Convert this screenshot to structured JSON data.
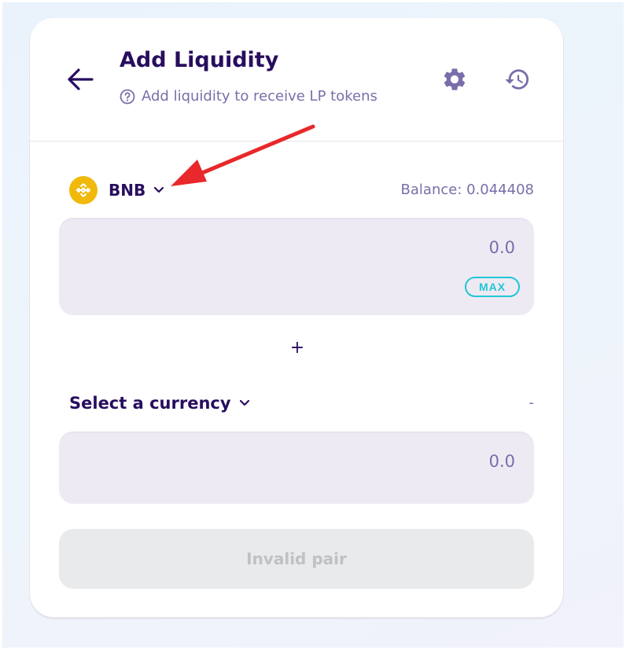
{
  "header": {
    "title": "Add Liquidity",
    "subtitle": "Add liquidity to receive LP tokens",
    "icons": [
      "back-arrow-icon",
      "help-circle-icon",
      "gear-icon",
      "history-icon"
    ]
  },
  "token_a": {
    "symbol": "BNB",
    "balance": "Balance: 0.044408",
    "amount": "0.0",
    "max_label": "MAX"
  },
  "plus_sign": "+",
  "token_b": {
    "label": "Select a currency",
    "balance": "-",
    "amount": "0.0"
  },
  "action_button": "Invalid pair",
  "colors": {
    "primary_text": "#280d5f",
    "secondary_text": "#7a6eaa",
    "input_bg": "#eeeaf4",
    "accent": "#1fc7d4",
    "bnb": "#f0b90b",
    "annotation_arrow": "#e8282b"
  }
}
